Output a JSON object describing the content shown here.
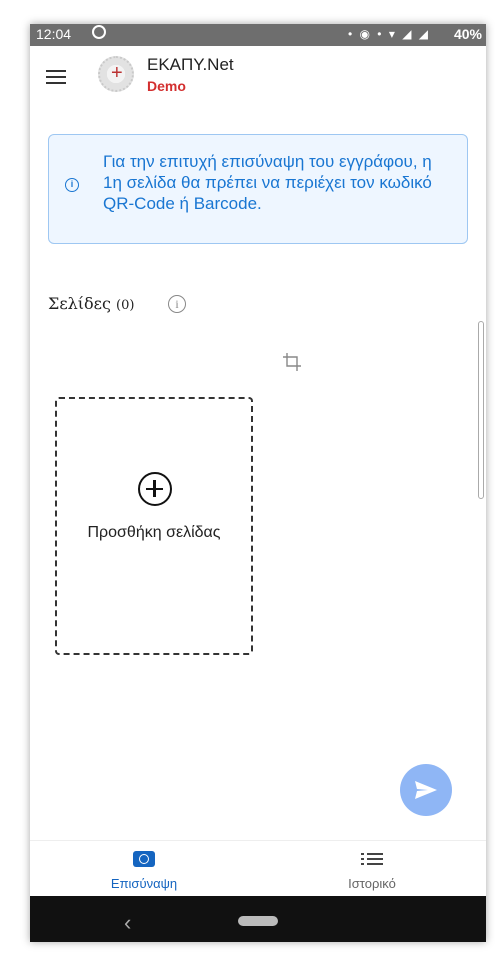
{
  "status_bar": {
    "time": "12:04",
    "battery": "40%"
  },
  "app": {
    "title": "ΕΚΑΠΥ.Net",
    "subtitle": "Demo"
  },
  "info_box": {
    "text": "Για την επιτυχή επισύναψη του εγγράφου, η 1η σελίδα θα πρέπει να περιέχει τον κωδικό QR-Code ή Barcode."
  },
  "pages": {
    "label": "Σελίδες",
    "count": "(0)"
  },
  "add_page": {
    "label": "Προσθήκη σελίδας"
  },
  "bottom_nav": [
    {
      "label": "Επισύναψη",
      "icon": "camera-icon",
      "active": true
    },
    {
      "label": "Ιστορικό",
      "icon": "list-icon",
      "active": false
    }
  ],
  "colors": {
    "accent": "#1976d2",
    "fab": "#8fb6f5",
    "demo": "#d32f2f"
  }
}
